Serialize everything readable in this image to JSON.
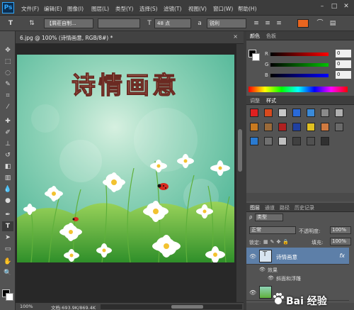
{
  "menubar": {
    "logo": "Ps",
    "items": [
      "文件(F)",
      "编辑(E)",
      "图像(I)",
      "图层(L)",
      "类型(Y)",
      "选择(S)",
      "滤镜(T)",
      "视图(V)",
      "窗口(W)",
      "帮助(H)"
    ]
  },
  "options": {
    "font_family": "【屑莊自制...",
    "font_size": "48 点",
    "anti_alias": "锐利",
    "text_color": "#e8651f"
  },
  "document": {
    "tab_label": "6.jpg @ 100% (诗情画意, RGB/8#) *",
    "canvas_title": "诗情画意"
  },
  "status": {
    "zoom": "100%",
    "doc_info": "文档:693.9K/869.4K"
  },
  "color_panel": {
    "tabs": [
      "颜色",
      "色板"
    ],
    "sliders": [
      {
        "letter": "R",
        "value": "0",
        "gradient": "linear-gradient(to right,#000,#ff0000)"
      },
      {
        "letter": "G",
        "value": "0",
        "gradient": "linear-gradient(to right,#000,#00c000)"
      },
      {
        "letter": "B",
        "value": "0",
        "gradient": "linear-gradient(to right,#000,#0000ff)"
      }
    ]
  },
  "style_panel": {
    "tabs": [
      "调整",
      "样式"
    ]
  },
  "layers_panel": {
    "tabs": [
      "图层",
      "通道",
      "路径",
      "历史记录"
    ],
    "filter_kind": "类型",
    "blend_mode": "正常",
    "opacity_label": "不透明度:",
    "opacity_value": "100%",
    "lock_label": "锁定:",
    "fill_label": "填充:",
    "fill_value": "100%",
    "layers": [
      {
        "name": "诗情画意",
        "fx": "fx"
      },
      {
        "name": "",
        "fx": ""
      }
    ],
    "effects_label": "效果",
    "effect_item": "斜面和浮雕"
  },
  "watermark": "Bai 经验"
}
